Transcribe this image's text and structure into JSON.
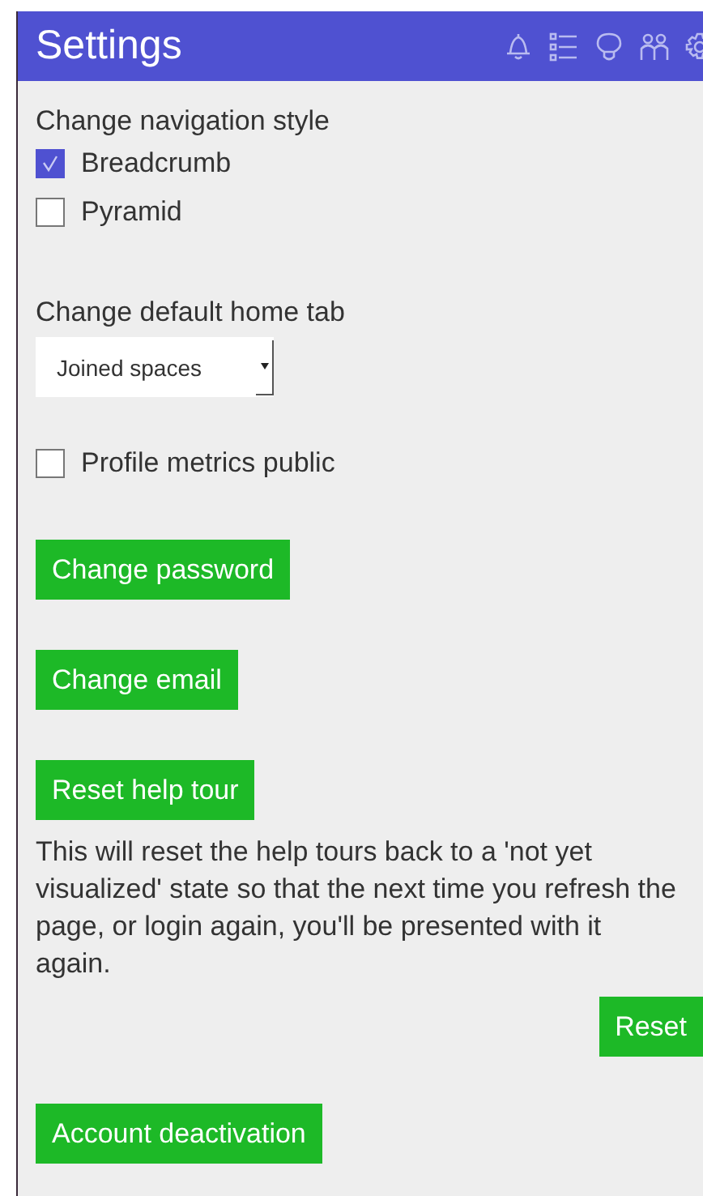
{
  "header": {
    "title": "Settings"
  },
  "navigation_style": {
    "label": "Change navigation style",
    "options": [
      {
        "label": "Breadcrumb",
        "checked": true
      },
      {
        "label": "Pyramid",
        "checked": false
      }
    ]
  },
  "home_tab": {
    "label": "Change default home tab",
    "value": "Joined spaces"
  },
  "profile_metrics": {
    "label": "Profile metrics public",
    "checked": false
  },
  "buttons": [
    {
      "label": "Change password"
    },
    {
      "label": "Change email"
    },
    {
      "label": "Reset help tour"
    }
  ],
  "help_tour_text": "This will reset the help tours back to a 'not yet visualized' state so that the next time you refresh the page, or login again, you'll be presented with it again.",
  "reset_button": "Reset",
  "deactivation_button": "Account deactivation"
}
